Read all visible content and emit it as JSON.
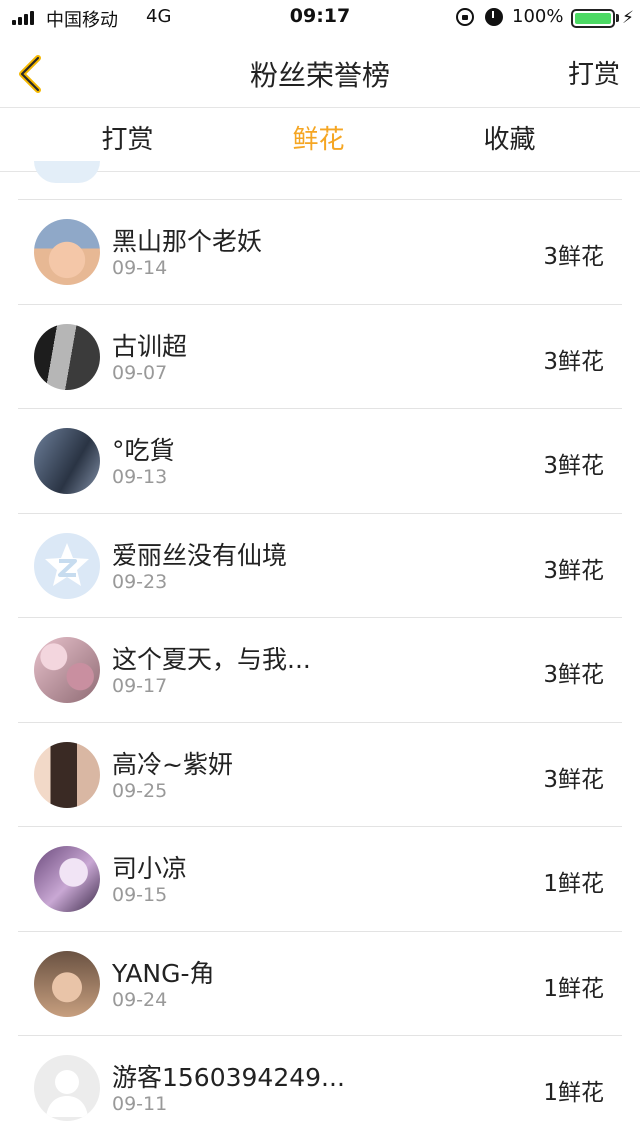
{
  "status_bar": {
    "carrier": "中国移动",
    "network": "4G",
    "time": "09:17",
    "battery": "100%",
    "battery_level": 1.0
  },
  "nav": {
    "title": "粉丝荣誉榜",
    "right_label": "打赏"
  },
  "tabs": [
    {
      "label": "打赏",
      "active": false
    },
    {
      "label": "鲜花",
      "active": true
    },
    {
      "label": "收藏",
      "active": false
    }
  ],
  "colors": {
    "accent": "#f5a623",
    "secondary_text": "#999999",
    "divider": "#e3e3e3",
    "battery": "#4cd964"
  },
  "fans": [
    {
      "name": "黑山那个老妖",
      "date": "09-14",
      "amount": "3鲜花",
      "avatar": "baby-photo"
    },
    {
      "name": "古训超",
      "date": "09-07",
      "amount": "3鲜花",
      "avatar": "man-photo"
    },
    {
      "name": "°吃貨",
      "date": "09-13",
      "amount": "3鲜花",
      "avatar": "hair-photo"
    },
    {
      "name": "爱丽丝没有仙境",
      "date": "09-23",
      "amount": "3鲜花",
      "avatar": "qzone-default-icon"
    },
    {
      "name": "这个夏天，与我...",
      "date": "09-17",
      "amount": "3鲜花",
      "avatar": "blossom-photo"
    },
    {
      "name": "高冷~紫妍",
      "date": "09-25",
      "amount": "3鲜花",
      "avatar": "braid-photo"
    },
    {
      "name": "司小凉",
      "date": "09-15",
      "amount": "1鲜花",
      "avatar": "anime-photo"
    },
    {
      "name": "YANG-角",
      "date": "09-24",
      "amount": "1鲜花",
      "avatar": "glasses-photo"
    },
    {
      "name": "游客1560394249...",
      "date": "09-11",
      "amount": "1鲜花",
      "avatar": "guest-default-icon"
    }
  ]
}
